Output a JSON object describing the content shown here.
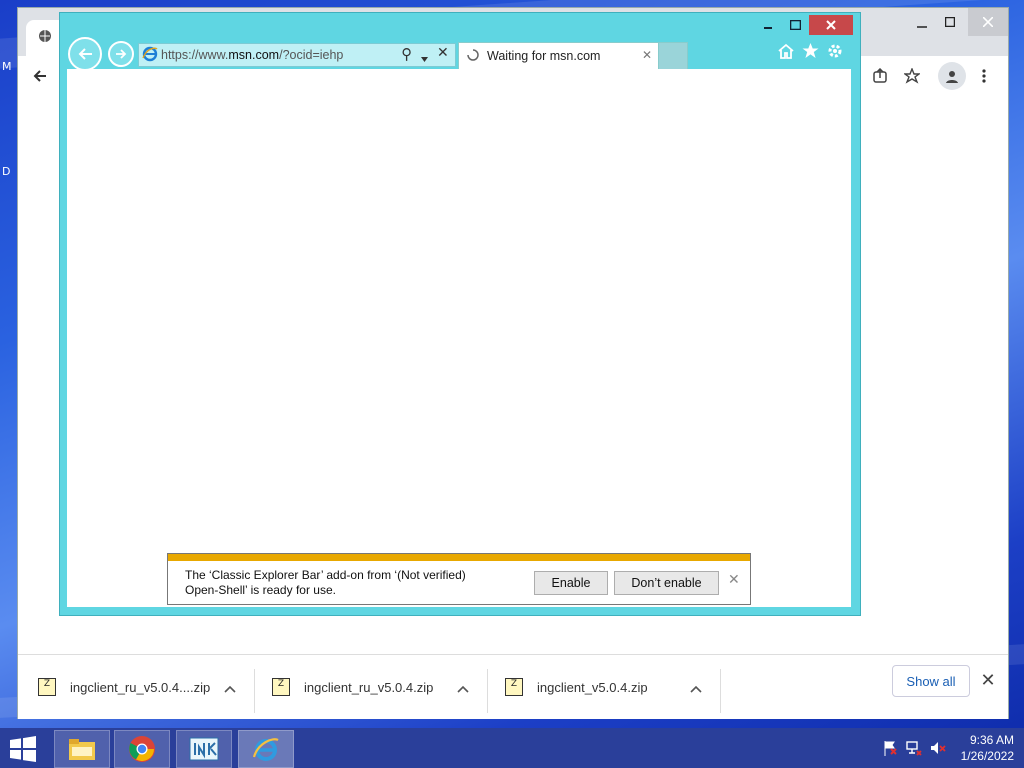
{
  "desktop": {
    "letters": [
      "M",
      "D"
    ]
  },
  "chrome": {
    "toolbar_icons": [
      "back-arrow-icon",
      "share-icon",
      "star-icon",
      "profile-icon",
      "more-icon"
    ],
    "controls": [
      "minimize",
      "maximize",
      "close"
    ],
    "downloads": {
      "items": [
        {
          "name": "ingclient_ru_v5.0.4....zip"
        },
        {
          "name": "ingclient_ru_v5.0.4.zip"
        },
        {
          "name": "ingclient_v5.0.4.zip"
        }
      ],
      "show_all_label": "Show all",
      "close_glyph": "✕"
    }
  },
  "ie": {
    "address": {
      "url_prefix": "https://www.",
      "url_host": "msn.com",
      "url_suffix": "/?ocid=iehp",
      "search_glyph": "⚲",
      "stop_glyph": "✕"
    },
    "tab": {
      "title": "Waiting for msn.com",
      "close_glyph": "✕"
    },
    "notification": {
      "line1": "The ‘Classic Explorer Bar’ add-on from ‘(Not verified)",
      "line2": "Open-Shell’ is ready for use.",
      "enable_label": "Enable",
      "dont_enable_label": "Don’t enable",
      "close_glyph": "✕"
    }
  },
  "taskbar": {
    "apps": [
      "file-explorer-icon",
      "chrome-icon",
      "ink-app-icon",
      "internet-explorer-icon"
    ],
    "clock": {
      "time": "9:36 AM",
      "date": "1/26/2022"
    }
  }
}
